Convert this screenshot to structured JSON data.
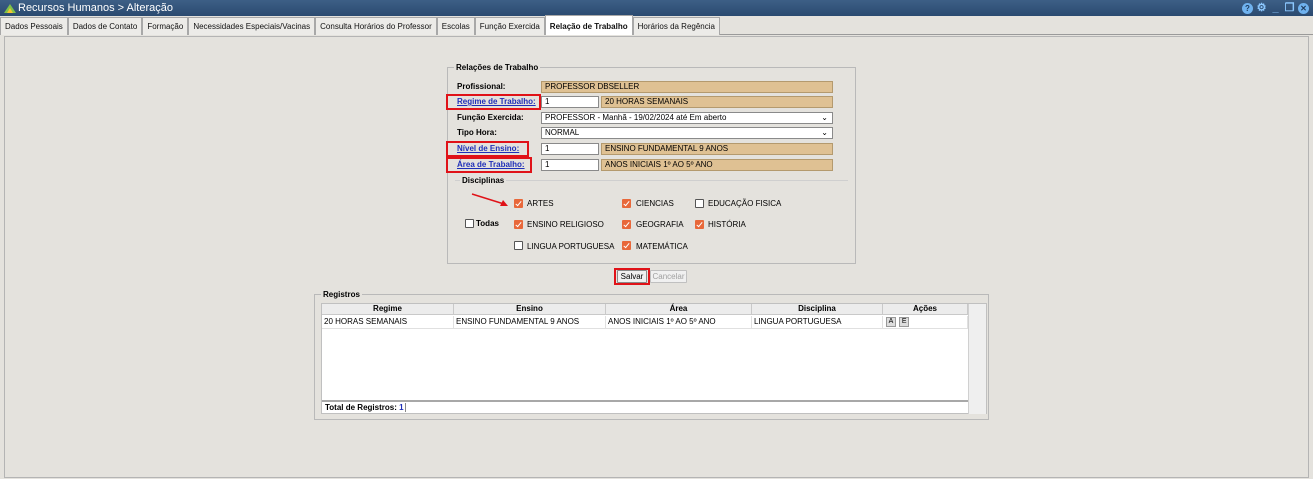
{
  "window": {
    "title": "Recursos Humanos > Alteração",
    "controls": [
      "help-icon",
      "settings-icon",
      "minimize-icon",
      "restore-icon",
      "close-icon"
    ]
  },
  "tabs": [
    {
      "label": "Dados Pessoais",
      "active": false
    },
    {
      "label": "Dados de Contato",
      "active": false
    },
    {
      "label": "Formação",
      "active": false
    },
    {
      "label": "Necessidades Especiais/Vacinas",
      "active": false
    },
    {
      "label": "Consulta Horários do Professor",
      "active": false
    },
    {
      "label": "Escolas",
      "active": false
    },
    {
      "label": "Função Exercida",
      "active": false
    },
    {
      "label": "Relação de Trabalho",
      "active": true
    },
    {
      "label": "Horários da Regência",
      "active": false
    }
  ],
  "form": {
    "legend": "Relações de Trabalho",
    "profissional_label": "Profissional:",
    "profissional_value": "PROFESSOR DBSELLER",
    "regime_label": "Regime de Trabalho:",
    "regime_code": "1",
    "regime_value": "20 HORAS SEMANAIS",
    "funcao_label": "Função Exercida:",
    "funcao_value": "PROFESSOR - Manhã - 19/02/2024 até Em aberto",
    "tipo_hora_label": "Tipo Hora:",
    "tipo_hora_value": "NORMAL",
    "nivel_label": "Nível de Ensino:",
    "nivel_code": "1",
    "nivel_value": "ENSINO FUNDAMENTAL 9 ANOS",
    "area_label": "Área de Trabalho:",
    "area_code": "1",
    "area_value": "ANOS INICIAIS 1º AO 5º ANO",
    "disciplinas_legend": "Disciplinas",
    "todas_label": "Todas",
    "todas_checked": false,
    "disciplinas": [
      {
        "label": "ARTES",
        "checked": true
      },
      {
        "label": "CIENCIAS",
        "checked": true
      },
      {
        "label": "EDUCAÇÃO FISICA",
        "checked": false
      },
      {
        "label": "ENSINO RELIGIOSO",
        "checked": true
      },
      {
        "label": "GEOGRAFIA",
        "checked": true
      },
      {
        "label": "HISTÓRIA",
        "checked": true
      },
      {
        "label": "LINGUA PORTUGUESA",
        "checked": false
      },
      {
        "label": "MATEMÁTICA",
        "checked": true
      }
    ],
    "annotation_color": "#e01218",
    "checkbox_color": "#e8683a"
  },
  "actions": {
    "save_label": "Salvar",
    "cancel_label": "Cancelar"
  },
  "registros": {
    "legend": "Registros",
    "columns": [
      "Regime",
      "Ensino",
      "Área",
      "Disciplina",
      "Ações"
    ],
    "rows": [
      {
        "regime": "20 HORAS SEMANAIS",
        "ensino": "ENSINO FUNDAMENTAL 9 ANOS",
        "area": "ANOS INICIAIS 1º AO 5º ANO",
        "disciplina": "LINGUA PORTUGUESA",
        "acoes": [
          "A",
          "E"
        ]
      }
    ],
    "total_label": "Total de Registros:",
    "total_value": "1"
  }
}
